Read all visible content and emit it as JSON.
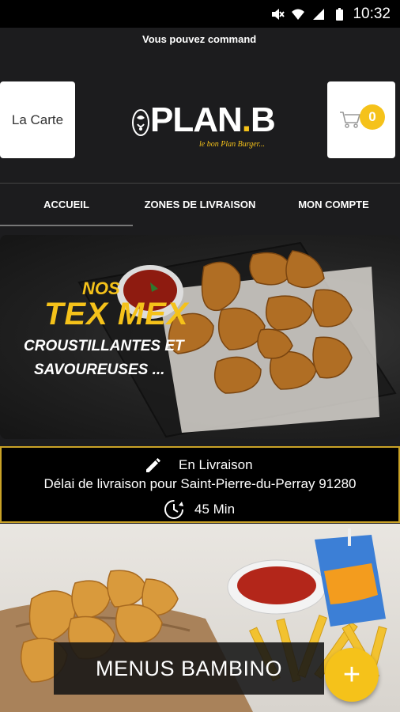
{
  "status_bar": {
    "time": "10:32"
  },
  "marquee": {
    "text": "Vous pouvez command"
  },
  "header": {
    "carte_label": "La Carte",
    "cart_count": "0",
    "logo": {
      "name_main": "PLAN",
      "name_dot": ".",
      "name_end": "B",
      "tagline": "le bon Plan Burger..."
    }
  },
  "nav": {
    "items": [
      {
        "label": "ACCUEIL"
      },
      {
        "label": "ZONES DE LIVRAISON"
      },
      {
        "label": "MON COMPTE"
      }
    ]
  },
  "banner_texmex": {
    "nos": "NOS",
    "title": "TEX MEX",
    "line1": "CROUSTILLANTES ET",
    "line2": "SAVOUREUSES ..."
  },
  "delivery": {
    "mode": "En Livraison",
    "delay_text": "Délai de livraison pour Saint-Pierre-du-Perray 91280",
    "duration": "45 Min"
  },
  "banner_bambino": {
    "label": "MENUS BAMBINO",
    "fab_symbol": "+"
  },
  "colors": {
    "accent": "#f5c21a",
    "background": "#1c1c1e",
    "border_gold": "#c9a227"
  }
}
